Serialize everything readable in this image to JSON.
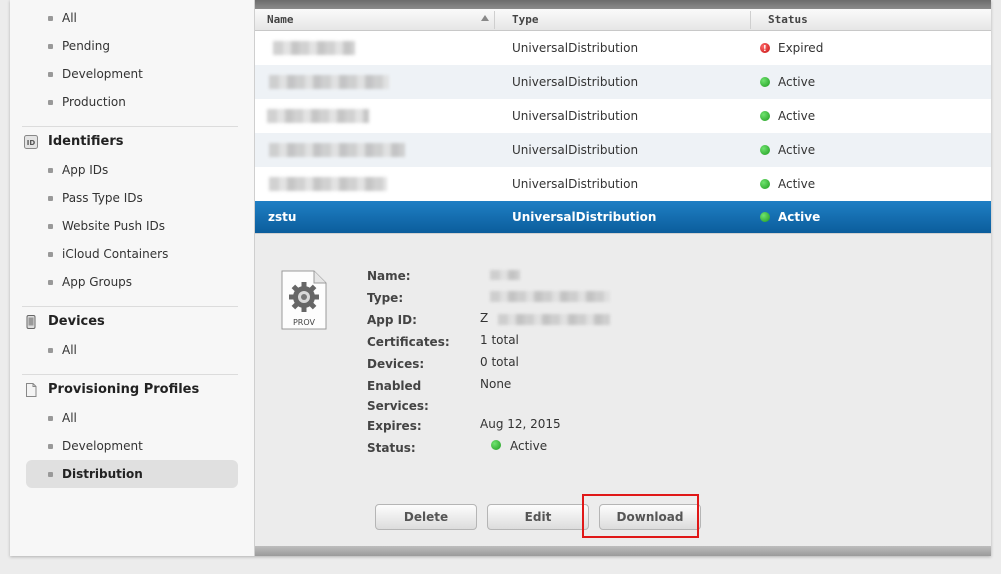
{
  "sidebar": {
    "cert_items": [
      "All",
      "Pending",
      "Development",
      "Production"
    ],
    "identifiers": {
      "title": "Identifiers",
      "items": [
        "App IDs",
        "Pass Type IDs",
        "Website Push IDs",
        "iCloud Containers",
        "App Groups"
      ]
    },
    "devices": {
      "title": "Devices",
      "items": [
        "All"
      ]
    },
    "profiles": {
      "title": "Provisioning Profiles",
      "items": [
        "All",
        "Development",
        "Distribution"
      ],
      "selected": "Distribution"
    }
  },
  "table": {
    "headers": [
      "Name",
      "Type",
      "Status"
    ],
    "rows": [
      {
        "name": "",
        "type": "UniversalDistribution",
        "status": "Expired"
      },
      {
        "name": "",
        "type": "UniversalDistribution",
        "status": "Active"
      },
      {
        "name": "",
        "type": "UniversalDistribution",
        "status": "Active"
      },
      {
        "name": "",
        "type": "UniversalDistribution",
        "status": "Active"
      },
      {
        "name": "",
        "type": "UniversalDistribution",
        "status": "Active"
      },
      {
        "name": "zstu",
        "type": "UniversalDistribution",
        "status": "Active"
      }
    ]
  },
  "detail": {
    "icon_label": "PROV",
    "labels": {
      "name": "Name:",
      "type": "Type:",
      "app_id": "App ID:",
      "certificates": "Certificates:",
      "devices": "Devices:",
      "enabled": "Enabled",
      "services": "Services:",
      "expires": "Expires:",
      "status": "Status:"
    },
    "values": {
      "app_id_prefix": "Z",
      "certificates": "1 total",
      "devices": "0 total",
      "services": "None",
      "expires": "Aug 12, 2015",
      "status": "Active"
    },
    "buttons": {
      "delete": "Delete",
      "edit": "Edit",
      "download": "Download"
    }
  },
  "colors": {
    "selected_row": "#0b5d9c",
    "active": "#1e9a1e",
    "expired": "#c41010",
    "highlight": "#e01818"
  }
}
